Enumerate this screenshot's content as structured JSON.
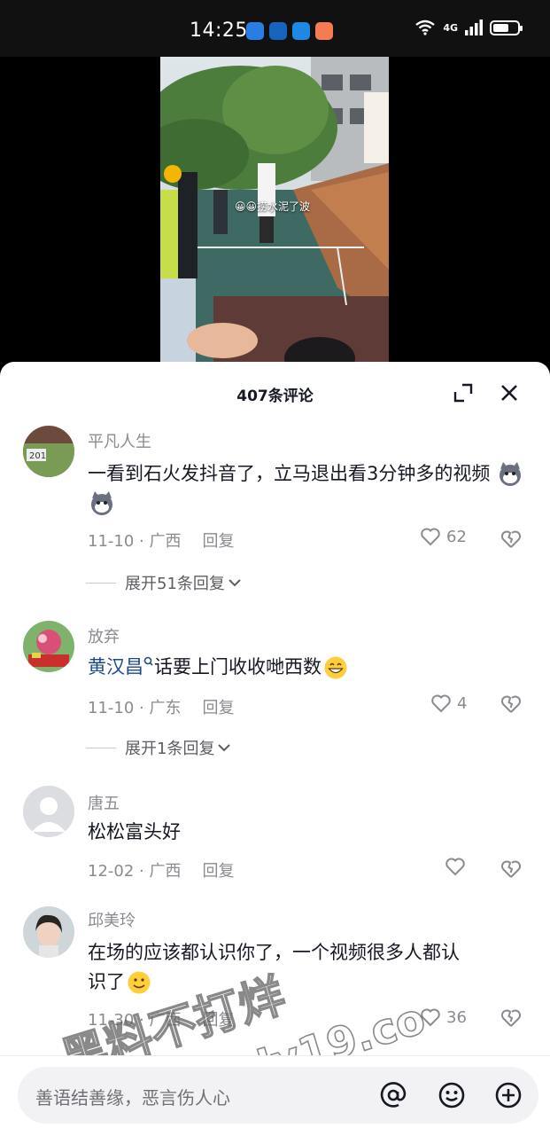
{
  "status_bar": {
    "time": "14:25",
    "network": "4G",
    "notification_colors": [
      "#2a7de1",
      "#1565c0",
      "#1e88e5",
      "#f57c52"
    ],
    "battery_level_percent": 65
  },
  "video": {
    "caption": "😀😀捞水泥了波"
  },
  "comments_sheet": {
    "title": "407条评论",
    "comments": [
      {
        "author": "平凡人生",
        "text": "一看到石火发抖音了，立马退出看3分钟多的视频",
        "emoji": "cat-emoji",
        "date_location": "11-10 · 广西",
        "reply_label": "回复",
        "likes": "62",
        "expand_replies": "展开51条回复"
      },
      {
        "author": "放弃",
        "mention": "黄汉昌",
        "text": "话要上门收收哋西数",
        "emoji": "grin-emoji",
        "date_location": "11-10 · 广东",
        "reply_label": "回复",
        "likes": "4",
        "expand_replies": "展开1条回复"
      },
      {
        "author": "唐五",
        "text": "松松富头好",
        "date_location": "12-02 · 广西",
        "reply_label": "回复",
        "likes": ""
      },
      {
        "author": "邱美玲",
        "text_line1": "在场的应该都认识你了，一个视频很多人都认",
        "text_line2": "识了",
        "date_location": "11-30 · 广西",
        "reply_label": "回复",
        "likes": "36"
      }
    ]
  },
  "watermark": {
    "line1": "黑料不打烊",
    "line2": "https://bdy19.co"
  },
  "input_bar": {
    "placeholder": "善语结善缘，恶言伤人心"
  }
}
